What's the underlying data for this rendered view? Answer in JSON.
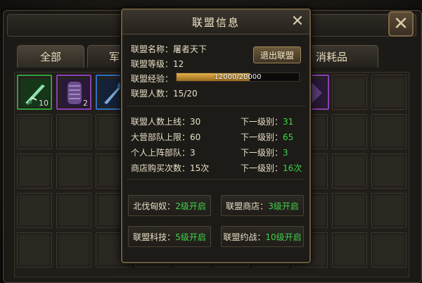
{
  "background": {
    "tabs": [
      {
        "label": "全部"
      },
      {
        "label": "军"
      },
      {
        "label": "消耗品"
      }
    ],
    "items": [
      {
        "icon": "green-sword-icon",
        "count": "10"
      },
      {
        "icon": "purple-armor-icon",
        "count": "2"
      },
      {
        "icon": "blue-weapon-icon",
        "count": ""
      }
    ]
  },
  "modal": {
    "title": "联盟信息",
    "quit_button": "退出联盟",
    "name_label": "联盟名称：",
    "name_value": "屠者天下",
    "level_label": "联盟等级：",
    "level_value": "12",
    "xp_label": "联盟经验：",
    "xp_current": 12000,
    "xp_max": 20000,
    "xp_text": "12000/20000",
    "members_label": "联盟人数：",
    "members_value": "15/20",
    "stats": [
      {
        "label": "联盟人数上线：",
        "value": "30",
        "next_label": "下一级别：",
        "next_value": "31"
      },
      {
        "label": "大营部队上限：",
        "value": "60",
        "next_label": "下一级别：",
        "next_value": "65"
      },
      {
        "label": "个人上阵部队：",
        "value": "3",
        "next_label": "下一级别：",
        "next_value": "3"
      },
      {
        "label": "商店购买次数：",
        "value": "15次",
        "next_label": "下一级别：",
        "next_value": "16次"
      }
    ],
    "features": [
      {
        "label": "北伐匈奴：",
        "status": "2级开启"
      },
      {
        "label": "联盟商店：",
        "status": "3级开启"
      },
      {
        "label": "联盟科技：",
        "status": "5级开启"
      },
      {
        "label": "联盟约战：",
        "status": "10级开启"
      }
    ],
    "colors": {
      "accent_green": "#3fd24a",
      "xp_gold": "#e3b04a",
      "frame": "#6b5a3f"
    }
  }
}
